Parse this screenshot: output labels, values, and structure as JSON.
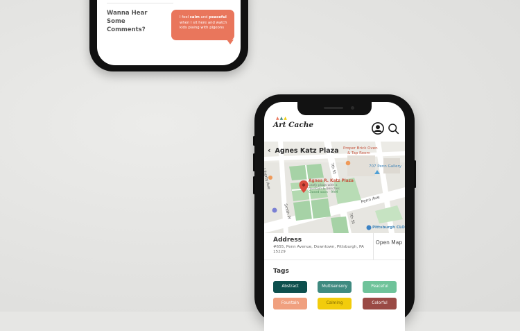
{
  "comments": {
    "prompt": "Wanna Hear Some Comments?",
    "bubble": {
      "text_pre": "I feel ",
      "word1": "calm",
      "text_mid": " and ",
      "word2": "peaceful",
      "text_post": " when I sit here and watch kids plaing with pigeons"
    }
  },
  "app": {
    "logo_text": "Art Cache",
    "location_title": "Agnes Katz Plaza",
    "address_heading": "Address",
    "address": "#655, Penn Avenue, Downtown, Pittsburgh, PA 15229",
    "open_map": "Open Map",
    "tags_heading": "Tags",
    "tags": [
      {
        "label": "Abstract",
        "color": "#0d4f4d"
      },
      {
        "label": "Multisensory",
        "color": "#3f8a80"
      },
      {
        "label": "Peaceful",
        "color": "#6fc39a"
      },
      {
        "label": "Fountain",
        "color": "#f0a07f"
      },
      {
        "label": "Calming",
        "color": "#f2cc0c"
      },
      {
        "label": "Colorful",
        "color": "#9a4a45"
      }
    ]
  },
  "map": {
    "pin_title": "Agnes R. Katz Plaza",
    "pin_desc1": "Leafy plaza with a",
    "pin_desc2": "fountain & benches",
    "pin_desc3": "Closed soon · 9AM",
    "streets": {
      "seventh_top": "7th St",
      "seventh_bottom": "7th St",
      "penn": "Penn Ave",
      "smith": "Smith Pl",
      "left": "Liberty Ave"
    },
    "poi": {
      "proper": "Proper Brick Oven",
      "proper2": "& Tap Room",
      "gallery": "707 Penn Gallery",
      "clo": "Pittsburgh CLO"
    }
  }
}
